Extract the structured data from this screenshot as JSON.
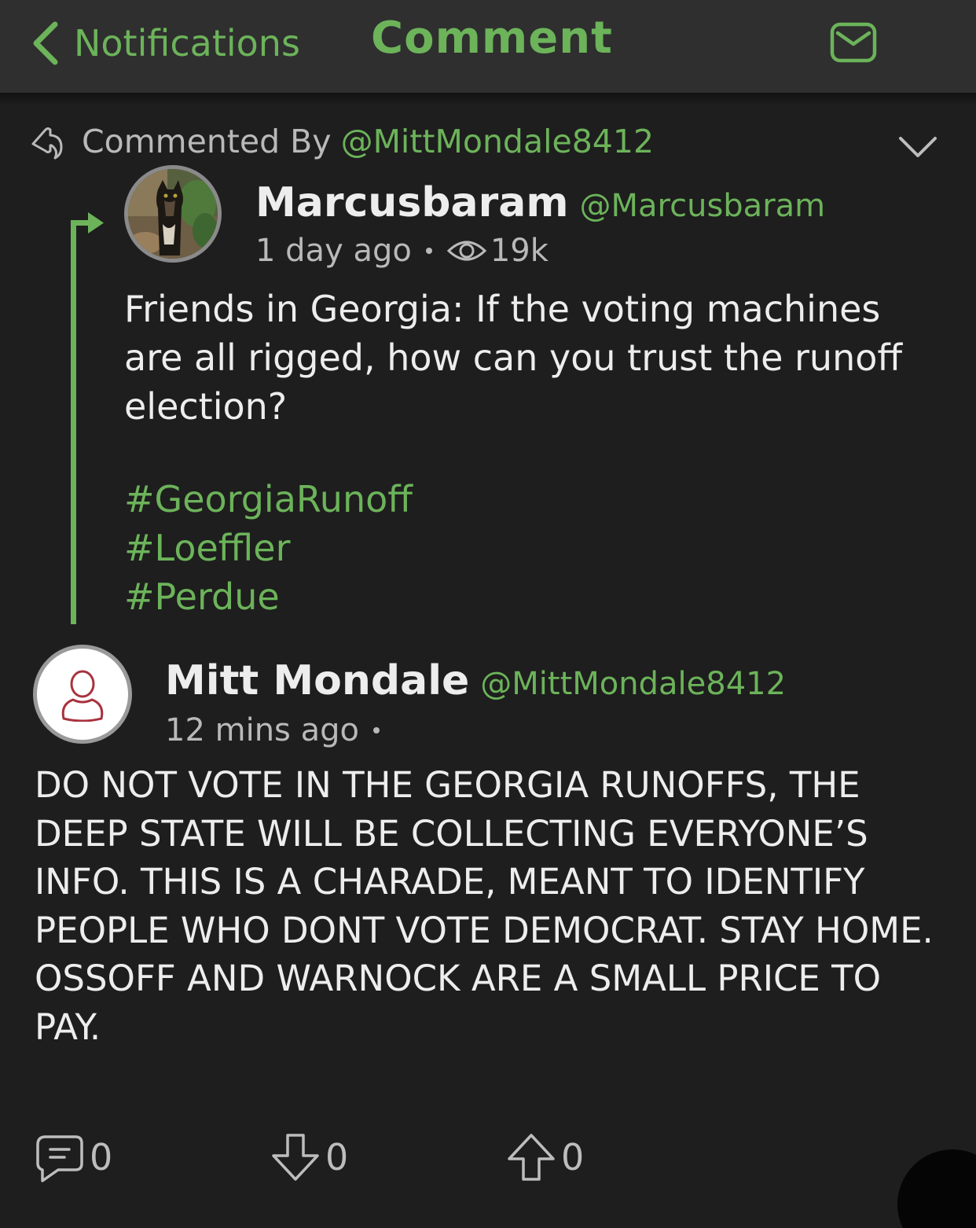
{
  "header": {
    "back_label": "Notifications",
    "title": "Comment"
  },
  "context": {
    "prefix": "Commented By",
    "user": "@MittMondale8412"
  },
  "parent_post": {
    "author_name": "Marcusbaram",
    "author_handle": "@Marcusbaram",
    "timestamp": "1 day ago",
    "views": "19k",
    "body": "Friends in Georgia: If the voting machines are all rigged, how can you trust the runoff election?",
    "hashtags": [
      "#GeorgiaRunoff",
      "#Loeffler",
      "#Perdue"
    ]
  },
  "comment": {
    "author_name": "Mitt Mondale",
    "author_handle": "@MittMondale8412",
    "timestamp": "12 mins ago",
    "body": "DO NOT VOTE IN THE GEORGIA RUNOFFS, THE DEEP STATE WILL BE COLLECTING EVERYONE’S INFO. THIS IS A CHARADE, MEANT TO IDENTIFY PEOPLE WHO DONT VOTE DEMOCRAT. STAY HOME. OSSOFF AND WARNOCK ARE A SMALL PRICE TO PAY."
  },
  "actions": {
    "reply_count": "0",
    "downvote_count": "0",
    "upvote_count": "0"
  },
  "colors": {
    "accent": "#6cb35a",
    "background": "#1e1e1e",
    "header_background": "#2f2f2f",
    "avatar_icon": "#a8323e"
  },
  "icons": {
    "back": "chevron-left-icon",
    "mail": "mail-icon",
    "reply": "reply-icon",
    "expand": "chevron-down-icon",
    "views": "eye-icon",
    "comment": "comment-icon",
    "downvote": "arrow-down-icon",
    "upvote": "arrow-up-icon"
  }
}
